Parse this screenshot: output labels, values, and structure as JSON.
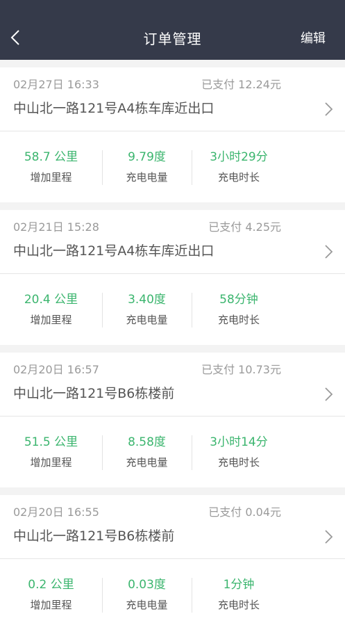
{
  "navbar": {
    "title": "订单管理",
    "edit_label": "编辑",
    "background": "#353a4a"
  },
  "accent_color": "#3bb56e",
  "orders": [
    {
      "time": "02月27日 16:33",
      "status": "已支付 12.24元",
      "location": "中山北一路121号A4栋车库近出口",
      "mileage": "58.7 公里",
      "mileage_label": "增加里程",
      "energy": "9.79度",
      "energy_label": "充电电量",
      "duration": "3小时29分",
      "duration_label": "充电时长"
    },
    {
      "time": "02月21日 15:28",
      "status": "已支付 4.25元",
      "location": "中山北一路121号A4栋车库近出口",
      "mileage": "20.4 公里",
      "mileage_label": "增加里程",
      "energy": "3.40度",
      "energy_label": "充电电量",
      "duration": "58分钟",
      "duration_label": "充电时长"
    },
    {
      "time": "02月20日 16:57",
      "status": "已支付 10.73元",
      "location": "中山北一路121号B6栋楼前",
      "mileage": "51.5 公里",
      "mileage_label": "增加里程",
      "energy": "8.58度",
      "energy_label": "充电电量",
      "duration": "3小时14分",
      "duration_label": "充电时长"
    },
    {
      "time": "02月20日 16:55",
      "status": "已支付 0.04元",
      "location": "中山北一路121号B6栋楼前",
      "mileage": "0.2 公里",
      "mileage_label": "增加里程",
      "energy": "0.03度",
      "energy_label": "充电电量",
      "duration": "1分钟",
      "duration_label": "充电时长"
    }
  ]
}
